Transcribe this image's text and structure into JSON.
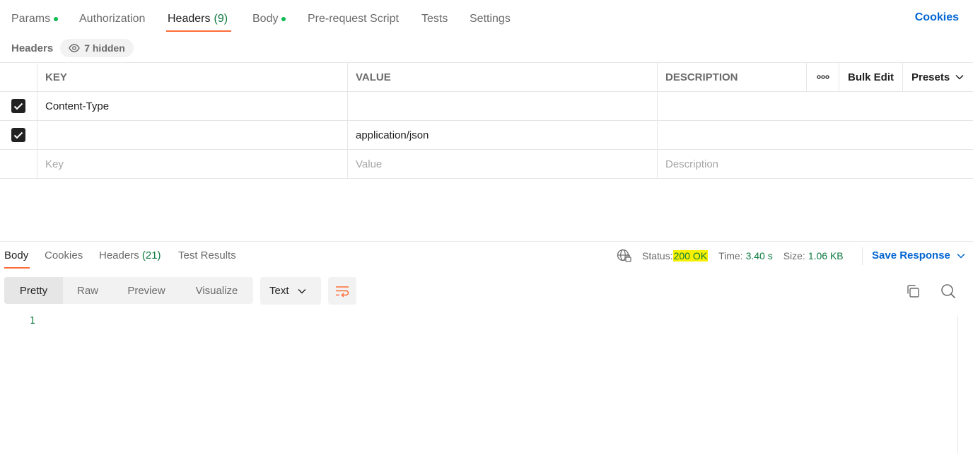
{
  "request_tabs": [
    {
      "label": "Params",
      "count": "",
      "dot": true
    },
    {
      "label": "Authorization",
      "count": "",
      "dot": false
    },
    {
      "label": "Headers",
      "count": "(9)",
      "dot": false
    },
    {
      "label": "Body",
      "count": "",
      "dot": true
    },
    {
      "label": "Pre-request Script",
      "count": "",
      "dot": false
    },
    {
      "label": "Tests",
      "count": "",
      "dot": false
    },
    {
      "label": "Settings",
      "count": "",
      "dot": false
    }
  ],
  "cookies_label": "Cookies",
  "headers_section": {
    "title": "Headers",
    "hidden_label": "7 hidden"
  },
  "table": {
    "columns": {
      "key": "KEY",
      "value": "VALUE",
      "description": "DESCRIPTION"
    },
    "more_glyph": "ooo",
    "bulk_edit_label": "Bulk Edit",
    "presets_label": "Presets",
    "rows": [
      {
        "checked": true,
        "key": "Content-Type",
        "value": "",
        "description": ""
      },
      {
        "checked": true,
        "key": "",
        "value": "application/json",
        "description": ""
      }
    ],
    "placeholders": {
      "key": "Key",
      "value": "Value",
      "description": "Description"
    }
  },
  "response_tabs": [
    {
      "label": "Body",
      "count": ""
    },
    {
      "label": "Cookies",
      "count": ""
    },
    {
      "label": "Headers",
      "count": "(21)"
    },
    {
      "label": "Test Results",
      "count": ""
    }
  ],
  "status": {
    "status_label": "Status:",
    "status_value": "200 OK",
    "time_label": "Time:",
    "time_value": "3.40 s",
    "size_label": "Size:",
    "size_value": "1.06 KB"
  },
  "save_response_label": "Save Response",
  "format_buttons": [
    "Pretty",
    "Raw",
    "Preview",
    "Visualize"
  ],
  "format_select": "Text",
  "editor": {
    "line_numbers": [
      "1"
    ]
  },
  "colors": {
    "accent": "#ff6c37",
    "link": "#0265d2",
    "success": "#0e7a3f",
    "dot": "#0cbb52",
    "highlight": "#f7f000"
  }
}
